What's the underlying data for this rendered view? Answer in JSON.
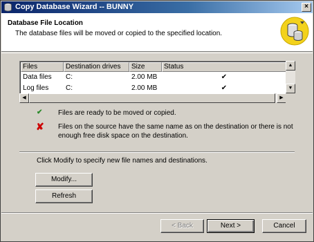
{
  "window": {
    "title": "Copy Database Wizard  -- BUNNY",
    "close_label": "×"
  },
  "header": {
    "title": "Database File Location",
    "subtitle": "The database files will be moved or copied to the specified location."
  },
  "listview": {
    "columns": [
      "Files",
      "Destination drives",
      "Size",
      "Status"
    ],
    "rows": [
      {
        "files": "Data files",
        "drive": "C:",
        "size": "2.00 MB",
        "status": "✔"
      },
      {
        "files": "Log files",
        "drive": "C:",
        "size": "2.00 MB",
        "status": "✔"
      }
    ]
  },
  "legend": {
    "ready_icon": "✔",
    "ready_text": "Files are ready to be moved or copied.",
    "error_icon": "✘",
    "error_line1": "Files on the source have the same name as on the destination or there is not",
    "error_line2": "enough free disk space on the destination."
  },
  "modify_hint": "Click Modify to specify new file names and destinations.",
  "buttons": {
    "modify": "Modify...",
    "refresh": "Refresh",
    "back": "< Back",
    "next": "Next >",
    "cancel": "Cancel"
  },
  "colors": {
    "title_bar": "#0a246a",
    "error_icon": "#cc0000",
    "ready_icon": "#2a8a2a",
    "logo": "#f3d21c"
  }
}
